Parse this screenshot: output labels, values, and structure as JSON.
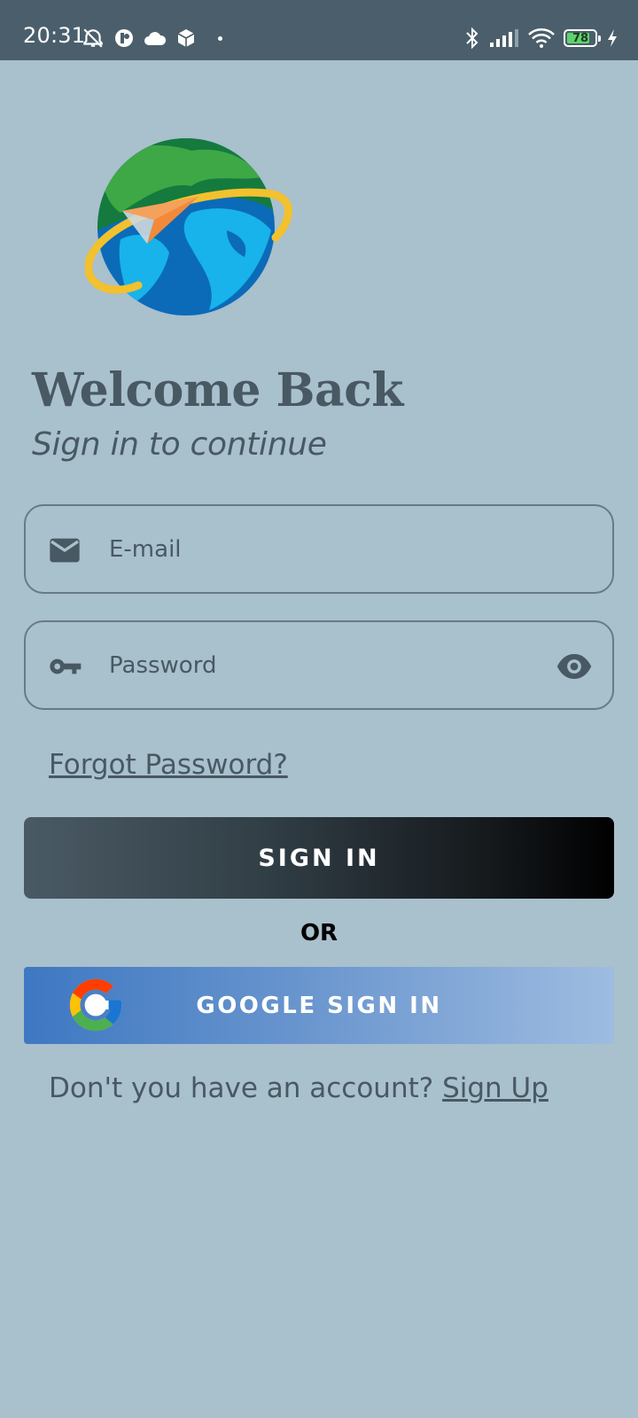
{
  "status_bar": {
    "time": "20:31",
    "battery_level": "78",
    "icons_left": [
      "alarm-off-icon",
      "app-notification-icon",
      "cloud-icon",
      "package-icon",
      "dot-icon"
    ],
    "icons_right": [
      "bluetooth-icon",
      "signal-icon",
      "wifi-icon",
      "battery-icon",
      "charging-icon"
    ]
  },
  "header": {
    "title": "Welcome Back",
    "subtitle": "Sign in to continue"
  },
  "form": {
    "email_placeholder": "E-mail",
    "email_value": "",
    "password_placeholder": "Password",
    "password_value": "",
    "forgot_password_label": "Forgot Password?",
    "sign_in_label": "SIGN IN",
    "or_label": "OR",
    "google_sign_in_label": "GOOGLE SIGN IN"
  },
  "footer": {
    "prompt": "Don't you have an account?",
    "sign_up_label": "Sign Up"
  },
  "colors": {
    "background": "#a9c0cd",
    "status_bar": "#4a5f6b",
    "text_primary": "#485963",
    "button_dark": "#000000",
    "google_blue": "#3e78c2"
  }
}
